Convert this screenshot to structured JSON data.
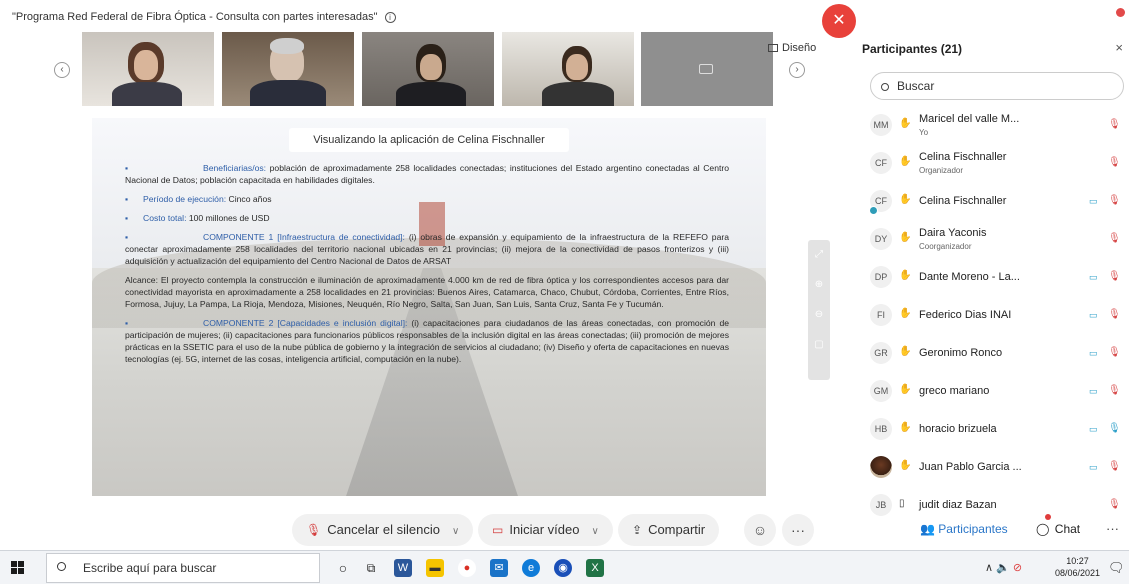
{
  "window": {
    "title": "\"Programa Red Federal de Fibra Óptica - Consulta con partes interesadas\"",
    "info_icon": "i"
  },
  "strip": {
    "prev": "‹",
    "next": "›",
    "layout_label": "Diseño"
  },
  "share": {
    "viewing_banner": "Visualizando la aplicación de Celina Fischnaller",
    "paragraphs": {
      "p1_label": "Beneficiarias/os:",
      "p1_text": "población de aproximadamente 258 localidades conectadas; instituciones del Estado argentino conectadas al Centro Nacional de Datos; población capacitada en habilidades digitales.",
      "p2_label": "Período de ejecución:",
      "p2_text": "Cinco años",
      "p3_label": "Costo total:",
      "p3_text": "100 millones de USD",
      "p4_label": "COMPONENTE 1 [Infraestructura de conectividad]:",
      "p4_text": "(i) obras de expansión y equipamiento de la infraestructura de la REFEFO para conectar aproximadamente 258 localidades del territorio nacional ubicadas en 21 provincias; (ii) mejora de la conectividad de pasos fronterizos y (iii) adquisición y actualización del equipamiento del Centro Nacional de Datos de ARSAT",
      "p5_text": "Alcance: El proyecto contempla la construcción e iluminación de aproximadamente 4.000 km de red de fibra óptica y los correspondientes accesos para dar conectividad mayorista en aproximadamente a 258 localidades en 21 provincias: Buenos Aires, Catamarca, Chaco, Chubut, Córdoba, Corrientes, Entre Ríos, Formosa, Jujuy, La Pampa, La Rioja, Mendoza, Misiones, Neuquén, Río Negro, Salta, San Juan, San Luis, Santa Cruz, Santa Fe y Tucumán.",
      "p6_label": "COMPONENTE 2 [Capacidades e inclusión digital]:",
      "p6_text": "(i) capacitaciones para ciudadanos de las áreas conectadas, con promoción de participación de mujeres; (ii) capacitaciones para funcionarios públicos responsables de la inclusión digital en las áreas conectadas; (iii) promoción de mejores prácticas en la SSETIC para el uso de la nube pública de gobierno y la integración de servicios al ciudadano; (iv) Diseño y oferta de capacitaciones en nuevas tecnologías (ej. 5G, internet de las cosas, inteligencia artificial, computación en la nube)."
    }
  },
  "controls": {
    "mute": "Cancelar el silencio",
    "video": "Iniciar vídeo",
    "share": "Compartir",
    "more": "···",
    "hangup": "✕"
  },
  "panel": {
    "title": "Participantes (21)",
    "close": "×",
    "search_placeholder": "Buscar",
    "participants": [
      {
        "initials": "MM",
        "name": "Maricel del valle M...",
        "role": "Yo",
        "video": false,
        "mic": "muted"
      },
      {
        "initials": "CF",
        "name": "Celina Fischnaller",
        "role": "Organizador",
        "video": false,
        "mic": "muted"
      },
      {
        "initials": "CF",
        "name": "Celina Fischnaller",
        "role": "",
        "video": true,
        "mic": "muted"
      },
      {
        "initials": "DY",
        "name": "Daira Yaconis",
        "role": "Coorganizador",
        "video": false,
        "mic": "muted"
      },
      {
        "initials": "DP",
        "name": "Dante Moreno - La...",
        "role": "",
        "video": true,
        "mic": "muted"
      },
      {
        "initials": "FI",
        "name": "Federico Dias INAI",
        "role": "",
        "video": true,
        "mic": "muted"
      },
      {
        "initials": "GR",
        "name": "Geronimo Ronco",
        "role": "",
        "video": true,
        "mic": "muted"
      },
      {
        "initials": "GM",
        "name": "greco mariano",
        "role": "",
        "video": true,
        "mic": "muted"
      },
      {
        "initials": "HB",
        "name": "horacio brizuela",
        "role": "",
        "video": true,
        "mic": "on"
      },
      {
        "initials": "",
        "name": "Juan Pablo Garcia ...",
        "role": "",
        "video": true,
        "mic": "muted"
      },
      {
        "initials": "JB",
        "name": "judit diaz Bazan",
        "role": "",
        "video": false,
        "mic": "muted"
      }
    ]
  },
  "footer": {
    "participants": "Participantes",
    "chat": "Chat",
    "more": "···"
  },
  "taskbar": {
    "search_placeholder": "Escribe aquí para buscar",
    "time": "10:27",
    "date": "08/06/2021"
  }
}
